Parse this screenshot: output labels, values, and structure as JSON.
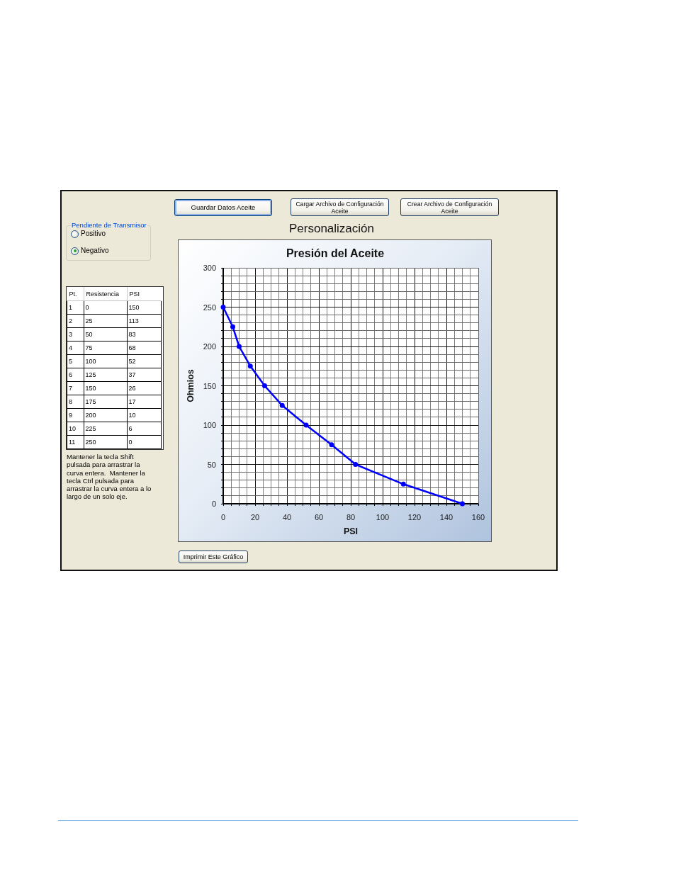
{
  "transmitter_slope": {
    "title": "Pendiente de Transmisor",
    "options": [
      {
        "label": "Positivo",
        "selected": false
      },
      {
        "label": "Negativo",
        "selected": true
      }
    ]
  },
  "table": {
    "columns": [
      "Pt.",
      "Resistencia",
      "PSI"
    ],
    "rows": [
      [
        "1",
        "0",
        "150"
      ],
      [
        "2",
        "25",
        "113"
      ],
      [
        "3",
        "50",
        "83"
      ],
      [
        "4",
        "75",
        "68"
      ],
      [
        "5",
        "100",
        "52"
      ],
      [
        "6",
        "125",
        "37"
      ],
      [
        "7",
        "150",
        "26"
      ],
      [
        "8",
        "175",
        "17"
      ],
      [
        "9",
        "200",
        "10"
      ],
      [
        "10",
        "225",
        "6"
      ],
      [
        "11",
        "250",
        "0"
      ]
    ]
  },
  "note": "Mantener la tecla Shift pulsada para arrastrar la curva entera.  Mantener la tecla Ctrl pulsada para arrastrar la curva entera a lo largo de un solo eje.",
  "buttons": [
    {
      "label": "Guardar Datos Aceite",
      "focused": true
    },
    {
      "label": "Cargar Archivo de Configuración Aceite",
      "focused": false
    },
    {
      "label": "Crear Archivo de Configuración Aceite",
      "focused": false
    }
  ],
  "heading": "Personalización",
  "chart": {
    "chart_data": {
      "type": "line",
      "title": "Presión del Aceite",
      "xlabel": "PSI",
      "ylabel": "Ohmios",
      "grid": true,
      "x": [
        0,
        6,
        10,
        17,
        26,
        37,
        52,
        68,
        83,
        113,
        150
      ],
      "series": [
        {
          "color": "#0000ff",
          "marker": "circle",
          "values": [
            250,
            225,
            200,
            175,
            150,
            125,
            100,
            75,
            50,
            25,
            0
          ]
        }
      ],
      "xlim": [
        0,
        160
      ],
      "ylim": [
        0,
        300
      ],
      "xticks": [
        0,
        20,
        40,
        60,
        80,
        100,
        120,
        140,
        160
      ],
      "yticks": [
        0,
        50,
        100,
        150,
        200,
        250,
        300
      ]
    }
  },
  "print_button": "Imprimir Este Gráfico"
}
